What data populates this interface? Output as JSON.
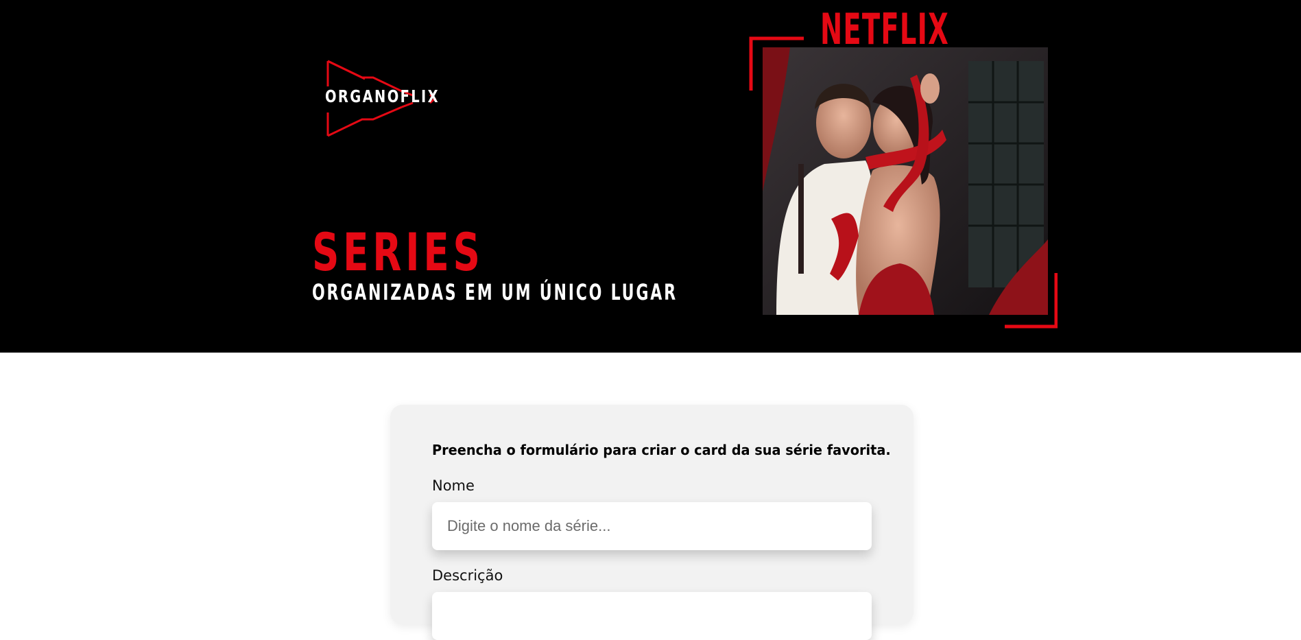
{
  "header": {
    "logo_text": "ORGANOFLIX",
    "headline_title": "SERIES",
    "headline_subtitle": "ORGANIZADAS EM UM ÚNICO LUGAR",
    "brand_word": "NETFLIX"
  },
  "form": {
    "intro": "Preencha o formulário para criar o card da sua série favorita.",
    "name_label": "Nome",
    "name_placeholder": "Digite o nome da série...",
    "description_label": "Descrição"
  },
  "colors": {
    "accent": "#e50914",
    "banner_bg": "#000000",
    "form_bg": "#f2f2f2"
  },
  "icons": {
    "logo": "triple-play-triangles-icon"
  }
}
